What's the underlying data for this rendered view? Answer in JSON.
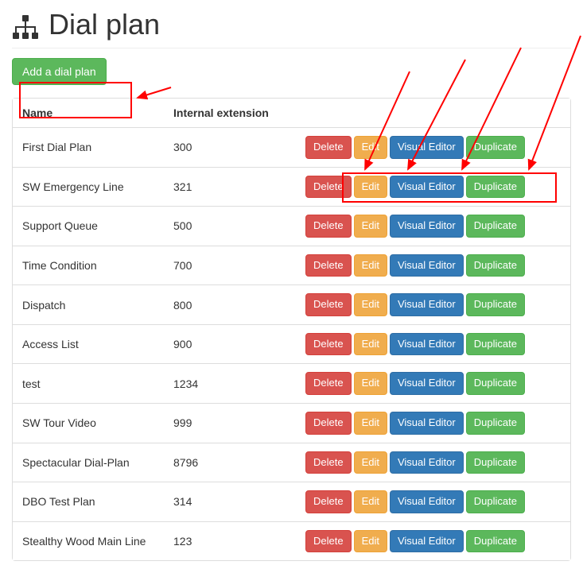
{
  "header": {
    "title": "Dial plan"
  },
  "toolbar": {
    "add_label": "Add a dial plan"
  },
  "table": {
    "headers": {
      "name": "Name",
      "internal_extension": "Internal extension"
    },
    "action_labels": {
      "delete": "Delete",
      "edit": "Edit",
      "visual_editor": "Visual Editor",
      "duplicate": "Duplicate"
    },
    "rows": [
      {
        "name": "First Dial Plan",
        "ext": "300"
      },
      {
        "name": "SW Emergency Line",
        "ext": "321"
      },
      {
        "name": "Support Queue",
        "ext": "500"
      },
      {
        "name": "Time Condition",
        "ext": "700"
      },
      {
        "name": "Dispatch",
        "ext": "800"
      },
      {
        "name": "Access List",
        "ext": "900"
      },
      {
        "name": "test",
        "ext": "1234"
      },
      {
        "name": "SW Tour Video",
        "ext": "999"
      },
      {
        "name": "Spectacular Dial-Plan",
        "ext": "8796"
      },
      {
        "name": "DBO Test Plan",
        "ext": "314"
      },
      {
        "name": "Stealthy Wood Main Line",
        "ext": "123"
      }
    ]
  },
  "colors": {
    "success": "#5cb85c",
    "danger": "#d9534f",
    "warning": "#f0ad4e",
    "primary": "#337ab7",
    "annotation": "#ff0000"
  }
}
